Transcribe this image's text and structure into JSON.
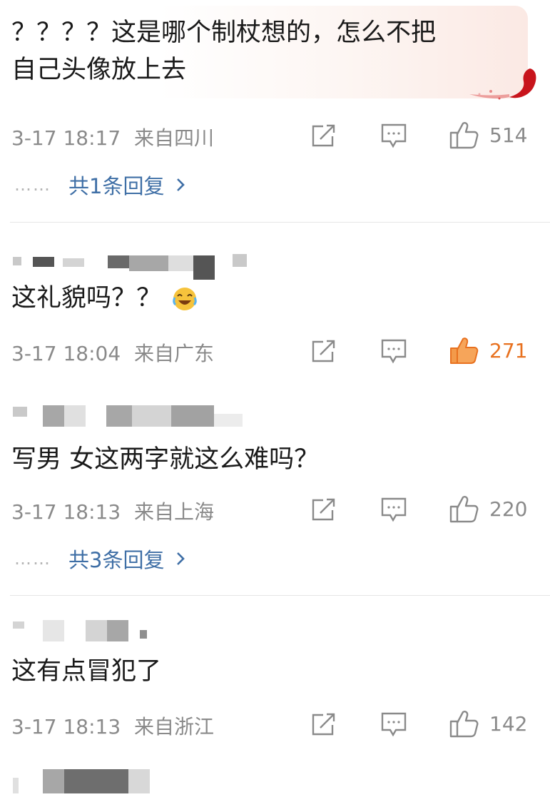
{
  "comments": [
    {
      "text_line1": "？？？？这是哪个制杖想的，怎么不把",
      "text_line2": "自己头像放上去",
      "time": "3-17 18:17",
      "location": "来自四川",
      "likes": "514",
      "liked": false,
      "replies": "共1条回复"
    },
    {
      "text": "这礼貌吗？？",
      "emoji": "laughing-crying-emoji",
      "time": "3-17 18:04",
      "location": "来自广东",
      "likes": "271",
      "liked": true
    },
    {
      "text": "写男  女这两字就这么难吗？",
      "time": "3-17 18:13",
      "location": "来自上海",
      "likes": "220",
      "liked": false,
      "replies": "共3条回复"
    },
    {
      "text": "这有点冒犯了",
      "time": "3-17 18:13",
      "location": "来自浙江",
      "likes": "142",
      "liked": false
    }
  ],
  "reply_dots": "……",
  "icons": {
    "share": "share-icon",
    "comment": "comment-icon",
    "like": "thumbs-up-icon",
    "chevron": "chevron-right-icon"
  },
  "colors": {
    "text": "#1a1a1a",
    "meta": "#8a8a8a",
    "reply_link": "#3f6fa6",
    "liked": "#e8711f"
  }
}
